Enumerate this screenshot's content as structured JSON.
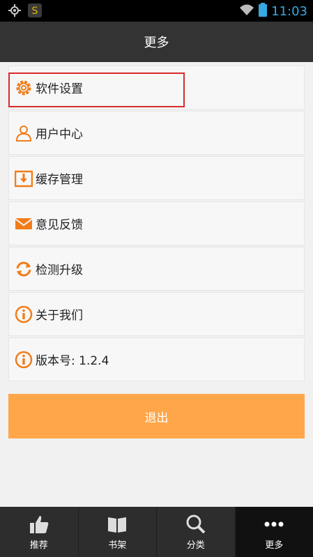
{
  "status_bar": {
    "time": "11:03"
  },
  "header": {
    "title": "更多"
  },
  "menu": {
    "items": [
      {
        "label": "软件设置",
        "icon": "gear-icon"
      },
      {
        "label": "用户中心",
        "icon": "user-icon"
      },
      {
        "label": "缓存管理",
        "icon": "download-box-icon"
      },
      {
        "label": "意见反馈",
        "icon": "mail-icon"
      },
      {
        "label": "检测升级",
        "icon": "refresh-icon"
      },
      {
        "label": "关于我们",
        "icon": "info-icon"
      },
      {
        "label": "版本号: 1.2.4",
        "icon": "info-icon"
      }
    ]
  },
  "logout": {
    "label": "退出"
  },
  "bottom_nav": {
    "items": [
      {
        "label": "推荐",
        "icon": "thumbs-up-icon"
      },
      {
        "label": "书架",
        "icon": "book-icon"
      },
      {
        "label": "分类",
        "icon": "search-icon"
      },
      {
        "label": "更多",
        "icon": "more-dots-icon"
      }
    ],
    "active_index": 3
  },
  "colors": {
    "accent": "#f07d1a",
    "button": "#ffa64a",
    "header": "#333333",
    "highlight": "#d82a2a"
  }
}
